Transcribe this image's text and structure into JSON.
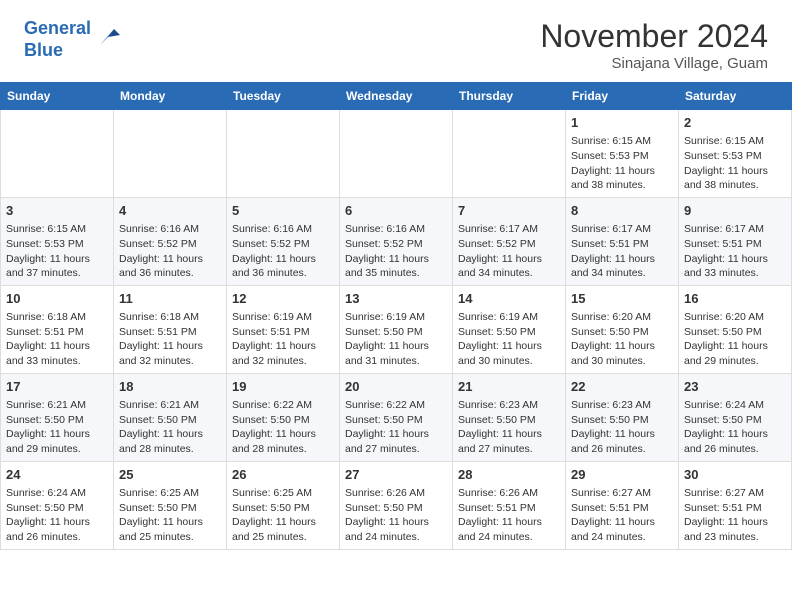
{
  "header": {
    "logo_line1": "General",
    "logo_line2": "Blue",
    "month_title": "November 2024",
    "subtitle": "Sinajana Village, Guam"
  },
  "weekdays": [
    "Sunday",
    "Monday",
    "Tuesday",
    "Wednesday",
    "Thursday",
    "Friday",
    "Saturday"
  ],
  "weeks": [
    [
      {
        "day": "",
        "info": ""
      },
      {
        "day": "",
        "info": ""
      },
      {
        "day": "",
        "info": ""
      },
      {
        "day": "",
        "info": ""
      },
      {
        "day": "",
        "info": ""
      },
      {
        "day": "1",
        "info": "Sunrise: 6:15 AM\nSunset: 5:53 PM\nDaylight: 11 hours\nand 38 minutes."
      },
      {
        "day": "2",
        "info": "Sunrise: 6:15 AM\nSunset: 5:53 PM\nDaylight: 11 hours\nand 38 minutes."
      }
    ],
    [
      {
        "day": "3",
        "info": "Sunrise: 6:15 AM\nSunset: 5:53 PM\nDaylight: 11 hours\nand 37 minutes."
      },
      {
        "day": "4",
        "info": "Sunrise: 6:16 AM\nSunset: 5:52 PM\nDaylight: 11 hours\nand 36 minutes."
      },
      {
        "day": "5",
        "info": "Sunrise: 6:16 AM\nSunset: 5:52 PM\nDaylight: 11 hours\nand 36 minutes."
      },
      {
        "day": "6",
        "info": "Sunrise: 6:16 AM\nSunset: 5:52 PM\nDaylight: 11 hours\nand 35 minutes."
      },
      {
        "day": "7",
        "info": "Sunrise: 6:17 AM\nSunset: 5:52 PM\nDaylight: 11 hours\nand 34 minutes."
      },
      {
        "day": "8",
        "info": "Sunrise: 6:17 AM\nSunset: 5:51 PM\nDaylight: 11 hours\nand 34 minutes."
      },
      {
        "day": "9",
        "info": "Sunrise: 6:17 AM\nSunset: 5:51 PM\nDaylight: 11 hours\nand 33 minutes."
      }
    ],
    [
      {
        "day": "10",
        "info": "Sunrise: 6:18 AM\nSunset: 5:51 PM\nDaylight: 11 hours\nand 33 minutes."
      },
      {
        "day": "11",
        "info": "Sunrise: 6:18 AM\nSunset: 5:51 PM\nDaylight: 11 hours\nand 32 minutes."
      },
      {
        "day": "12",
        "info": "Sunrise: 6:19 AM\nSunset: 5:51 PM\nDaylight: 11 hours\nand 32 minutes."
      },
      {
        "day": "13",
        "info": "Sunrise: 6:19 AM\nSunset: 5:50 PM\nDaylight: 11 hours\nand 31 minutes."
      },
      {
        "day": "14",
        "info": "Sunrise: 6:19 AM\nSunset: 5:50 PM\nDaylight: 11 hours\nand 30 minutes."
      },
      {
        "day": "15",
        "info": "Sunrise: 6:20 AM\nSunset: 5:50 PM\nDaylight: 11 hours\nand 30 minutes."
      },
      {
        "day": "16",
        "info": "Sunrise: 6:20 AM\nSunset: 5:50 PM\nDaylight: 11 hours\nand 29 minutes."
      }
    ],
    [
      {
        "day": "17",
        "info": "Sunrise: 6:21 AM\nSunset: 5:50 PM\nDaylight: 11 hours\nand 29 minutes."
      },
      {
        "day": "18",
        "info": "Sunrise: 6:21 AM\nSunset: 5:50 PM\nDaylight: 11 hours\nand 28 minutes."
      },
      {
        "day": "19",
        "info": "Sunrise: 6:22 AM\nSunset: 5:50 PM\nDaylight: 11 hours\nand 28 minutes."
      },
      {
        "day": "20",
        "info": "Sunrise: 6:22 AM\nSunset: 5:50 PM\nDaylight: 11 hours\nand 27 minutes."
      },
      {
        "day": "21",
        "info": "Sunrise: 6:23 AM\nSunset: 5:50 PM\nDaylight: 11 hours\nand 27 minutes."
      },
      {
        "day": "22",
        "info": "Sunrise: 6:23 AM\nSunset: 5:50 PM\nDaylight: 11 hours\nand 26 minutes."
      },
      {
        "day": "23",
        "info": "Sunrise: 6:24 AM\nSunset: 5:50 PM\nDaylight: 11 hours\nand 26 minutes."
      }
    ],
    [
      {
        "day": "24",
        "info": "Sunrise: 6:24 AM\nSunset: 5:50 PM\nDaylight: 11 hours\nand 26 minutes."
      },
      {
        "day": "25",
        "info": "Sunrise: 6:25 AM\nSunset: 5:50 PM\nDaylight: 11 hours\nand 25 minutes."
      },
      {
        "day": "26",
        "info": "Sunrise: 6:25 AM\nSunset: 5:50 PM\nDaylight: 11 hours\nand 25 minutes."
      },
      {
        "day": "27",
        "info": "Sunrise: 6:26 AM\nSunset: 5:50 PM\nDaylight: 11 hours\nand 24 minutes."
      },
      {
        "day": "28",
        "info": "Sunrise: 6:26 AM\nSunset: 5:51 PM\nDaylight: 11 hours\nand 24 minutes."
      },
      {
        "day": "29",
        "info": "Sunrise: 6:27 AM\nSunset: 5:51 PM\nDaylight: 11 hours\nand 24 minutes."
      },
      {
        "day": "30",
        "info": "Sunrise: 6:27 AM\nSunset: 5:51 PM\nDaylight: 11 hours\nand 23 minutes."
      }
    ]
  ]
}
